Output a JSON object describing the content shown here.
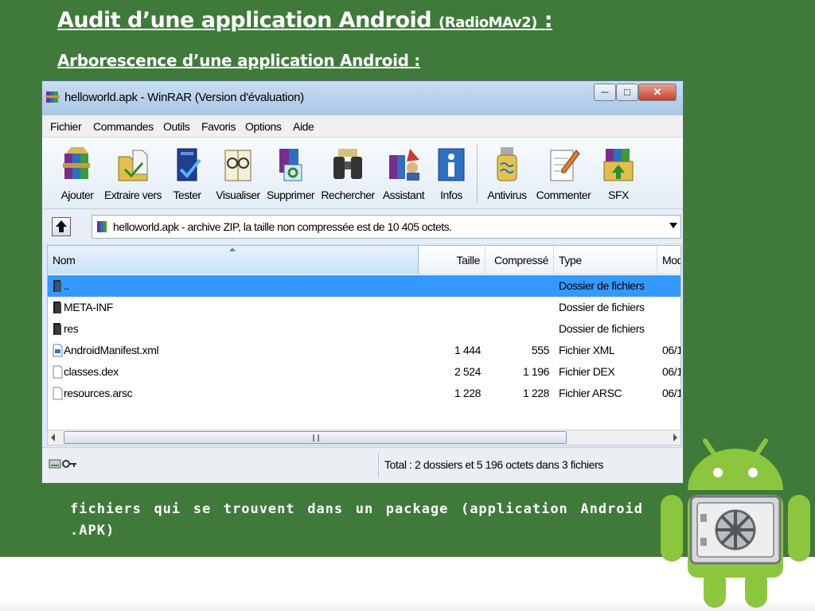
{
  "slide": {
    "title_main": "Audit d’une application Android",
    "title_paren": "(RadioMAv2)",
    "title_colon": ":",
    "subtitle": "Arborescence d’une application Android :",
    "caption_line1": "fichiers qui se trouvent dans un package (application Android",
    "caption_line2": ".APK)"
  },
  "window": {
    "title": "helloworld.apk - WinRAR (Version d'évaluation)",
    "buttons": {
      "minimize": "─",
      "maximize": "□",
      "close": "✕"
    }
  },
  "menu": [
    "Fichier",
    "Commandes",
    "Outils",
    "Favoris",
    "Options",
    "Aide"
  ],
  "toolbar": [
    {
      "label": "Ajouter",
      "icon": "books-add-icon"
    },
    {
      "label": "Extraire vers",
      "icon": "extract-folder-icon"
    },
    {
      "label": "Tester",
      "icon": "test-check-icon"
    },
    {
      "label": "Visualiser",
      "icon": "glasses-book-icon"
    },
    {
      "label": "Supprimer",
      "icon": "recycle-delete-icon"
    },
    {
      "label": "Rechercher",
      "icon": "binoculars-icon"
    },
    {
      "label": "Assistant",
      "icon": "wizard-icon"
    },
    {
      "label": "Infos",
      "icon": "info-icon"
    },
    {
      "label": "Antivirus",
      "icon": "antivirus-icon"
    },
    {
      "label": "Commenter",
      "icon": "comment-pen-icon"
    },
    {
      "label": "SFX",
      "icon": "sfx-box-icon"
    }
  ],
  "address": {
    "text": "helloworld.apk - archive ZIP, la taille non compressée est de 10 405 octets."
  },
  "columns": {
    "name": "Nom",
    "size": "Taille",
    "compressed": "Compressé",
    "type": "Type",
    "modified": "Mod"
  },
  "files": [
    {
      "name": "..",
      "size": "",
      "compressed": "",
      "type": "Dossier de fichiers",
      "date": "",
      "kind": "folder",
      "selected": true
    },
    {
      "name": "META-INF",
      "size": "",
      "compressed": "",
      "type": "Dossier de fichiers",
      "date": "",
      "kind": "folder",
      "selected": false
    },
    {
      "name": "res",
      "size": "",
      "compressed": "",
      "type": "Dossier de fichiers",
      "date": "",
      "kind": "folder",
      "selected": false
    },
    {
      "name": "AndroidManifest.xml",
      "size": "1 444",
      "compressed": "555",
      "type": "Fichier XML",
      "date": "06/1",
      "kind": "file",
      "selected": false
    },
    {
      "name": "classes.dex",
      "size": "2 524",
      "compressed": "1 196",
      "type": "Fichier DEX",
      "date": "06/1",
      "kind": "file",
      "selected": false
    },
    {
      "name": "resources.arsc",
      "size": "1 228",
      "compressed": "1 228",
      "type": "Fichier ARSC",
      "date": "06/1",
      "kind": "file",
      "selected": false
    }
  ],
  "scrollbar": {
    "grip": "III"
  },
  "status": {
    "text": "Total : 2 dossiers et 5 196 octets dans 3 fichiers"
  },
  "colors": {
    "slide_green": "#3f7a3a",
    "selection_blue": "#3399ff",
    "android_green": "#8cc63f"
  }
}
